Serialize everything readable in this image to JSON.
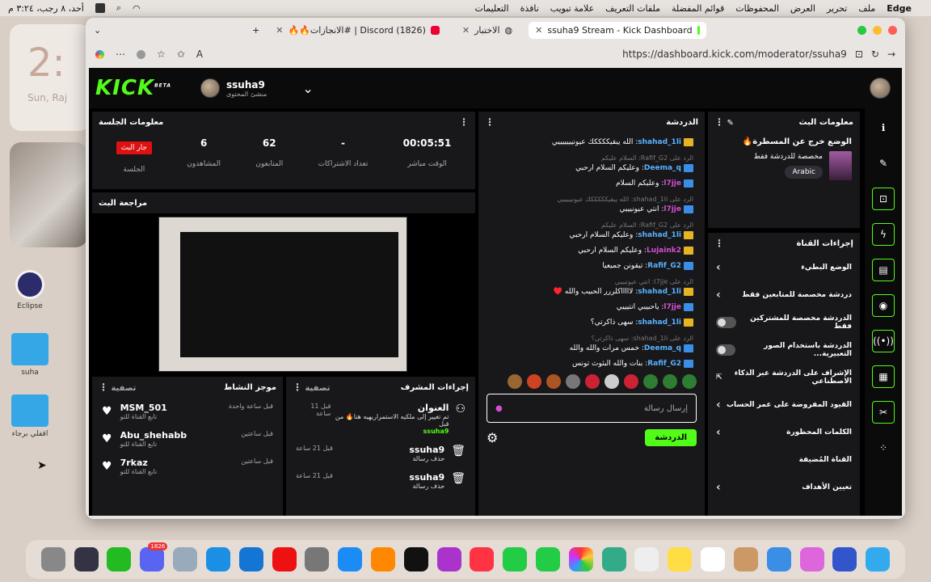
{
  "menubar": {
    "brand": "Edge",
    "items": [
      "ملف",
      "تحرير",
      "العرض",
      "المحفوظات",
      "قوائم المفضلة",
      "ملفات التعريف",
      "علامة تبويب",
      "نافذة",
      "التعليمات"
    ],
    "datetime": "أحد، ٨ رجب، ٣:٢٤ م"
  },
  "desktop": {
    "clock_time": "2:",
    "clock_date": "Sun, Raj",
    "icons": [
      "Eclipse",
      "Visu",
      "suha",
      "اقفلي برجاء"
    ]
  },
  "browser": {
    "tabs": [
      {
        "title": "ssuha9 Stream - Kick Dashboard",
        "active": true
      },
      {
        "title": "الاختبار",
        "active": false
      },
      {
        "title": "(1826) Discord | #الانجازات🔥🔥",
        "active": false
      }
    ],
    "new_tab": "+",
    "url": "https://dashboard.kick.com/moderator/ssuha9"
  },
  "kick": {
    "logo": "KICK",
    "logo_sup": "BETA",
    "username": "ssuha9",
    "role": "منشئ المحتوى"
  },
  "stream_info": {
    "title": "معلومات البث",
    "stream_title": "🔥الوضع خرج عن المسطرة",
    "category": "مخصصة للدردشة فقط",
    "language": "Arabic"
  },
  "channel_actions": {
    "title": "إجراءات القناة",
    "items": [
      {
        "label": "الوضع البطيء",
        "control": "chevron"
      },
      {
        "label": "دردشة مخصصة للمتابعين فقط",
        "control": "chevron"
      },
      {
        "label": "الدردشة مخصصة للمشتركين فقط",
        "control": "toggle"
      },
      {
        "label": "الدردشة باستخدام الصور التعبيرية...",
        "control": "toggle"
      },
      {
        "label": "الإشراف على الدردشة عبر الذكاء الاصطناعي",
        "control": "icon"
      },
      {
        "label": "القيود المفروضة على عمر الحساب",
        "control": "chevron"
      },
      {
        "label": "الكلمات المحظورة",
        "control": "chevron"
      },
      {
        "label": "القناة المُضيفة",
        "control": "none"
      },
      {
        "label": "تعيين الأهداف",
        "control": "chevron"
      }
    ]
  },
  "chat": {
    "title": "الدردشة",
    "messages": [
      {
        "reply": "",
        "user": "shahad_1li",
        "text": "الله يبقيككككك عيونيييييييي",
        "badge": "crown",
        "color": "blue"
      },
      {
        "reply": "الرد على Rafif_G2: السلام عليكم",
        "user": "Deema_q",
        "text": "وعليكم السلام ارحبي",
        "badge": "mod",
        "color": "blue"
      },
      {
        "reply": "",
        "user": "l7jje",
        "text": "وعليكم السلام",
        "badge": "mod",
        "color": "pink"
      },
      {
        "reply": "الرد على shahad_1li: الله يبقيكككككك عيونيييييي",
        "user": "l7jje",
        "text": "انتي عيونيييي",
        "badge": "mod",
        "color": "pink"
      },
      {
        "reply": "الرد على Rafif_G2: السلام عليكم",
        "user": "shahad_1li",
        "text": "وعليكم السلام ارحبي",
        "badge": "crown",
        "color": "blue"
      },
      {
        "reply": "",
        "user": "Lujaink2",
        "text": "وعليكم السلام ارحبي",
        "badge": "crown",
        "color": "pink"
      },
      {
        "reply": "",
        "user": "Rafif_G2",
        "text": "تيقونن جميعيا",
        "badge": "mod",
        "color": "blue"
      },
      {
        "reply": "الرد على l7jje: انتي عيونيييي",
        "user": "shahad_1li",
        "text": "لاااااكلررر الحبيب والله ♥️",
        "badge": "crown",
        "color": "blue"
      },
      {
        "reply": "",
        "user": "l7jje",
        "text": "ياحبيبي انتيييي",
        "badge": "mod",
        "color": "pink"
      },
      {
        "reply": "",
        "user": "shahad_1li",
        "text": "سهى ذاكرتي؟",
        "badge": "crown",
        "color": "blue"
      },
      {
        "reply": "الرد على shahad_1li: سهى ذاكرتي؟",
        "user": "Deema_q",
        "text": "خمس مرات والله والله",
        "badge": "mod",
        "color": "blue"
      },
      {
        "reply": "",
        "user": "Rafif_G2",
        "text": "بنات والله البثوث تونس",
        "badge": "mod",
        "color": "blue"
      }
    ],
    "input_placeholder": "إرسال رسالة",
    "send_label": "الدردشة"
  },
  "session": {
    "title": "معلومات الجلسة",
    "live_label": "جار البث",
    "session_label": "الجلسة",
    "stats": [
      {
        "value": "00:05:51",
        "label": "الوقت مباشر"
      },
      {
        "value": "-",
        "label": "تعداد الاشتراكات"
      },
      {
        "value": "62",
        "label": "المتابعون"
      },
      {
        "value": "6",
        "label": "المشاهدون"
      }
    ]
  },
  "preview": {
    "title": "مراجعة البث"
  },
  "mod_actions": {
    "title": "إجراءات المشرف",
    "filter": "تصفية",
    "items": [
      {
        "user": "العنوان",
        "time": "قبل 11 ساعة",
        "detail": "تم تغيير إلى ملكيه الاستمراريهيه هنا🔥 من قبل",
        "by": "ssuha9"
      },
      {
        "user": "ssuha9",
        "time": "قبل 21 ساعة",
        "detail": "حذف رسالة",
        "by": ""
      },
      {
        "user": "ssuha9",
        "time": "قبل 21 ساعة",
        "detail": "حذف رسالة",
        "by": ""
      }
    ]
  },
  "activity": {
    "title": "موجز النشاط",
    "filter": "تصفية",
    "items": [
      {
        "user": "MSM_501",
        "detail": "تابع القناة للتو",
        "time": "قبل ساعة واحدة"
      },
      {
        "user": "Abu_shehabb",
        "detail": "تابع القناة للتو",
        "time": "قبل ساعتين"
      },
      {
        "user": "7rkaz",
        "detail": "تابع القناة للتو",
        "time": "قبل ساعتين"
      }
    ]
  },
  "dock": {
    "discord_badge": "1826"
  },
  "colors": {
    "kick_green": "#53fc18",
    "panel": "#18181b",
    "live_red": "#dd1111"
  }
}
